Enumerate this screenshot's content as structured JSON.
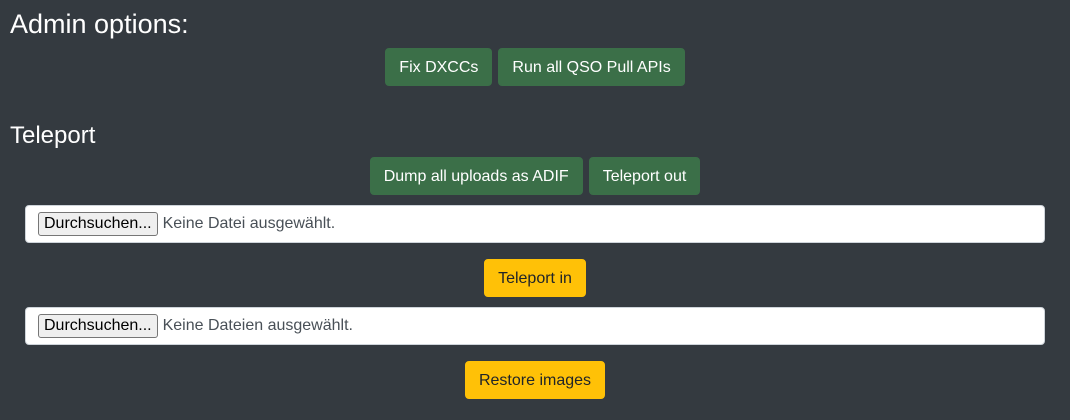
{
  "admin": {
    "title": "Admin options:",
    "buttons": {
      "fix_dxccs": "Fix DXCCs",
      "run_qso_pull": "Run all QSO Pull APIs"
    }
  },
  "teleport": {
    "title": "Teleport",
    "buttons": {
      "dump_adif": "Dump all uploads as ADIF",
      "teleport_out": "Teleport out",
      "teleport_in": "Teleport in",
      "restore_images": "Restore images"
    },
    "file_input_single": {
      "browse_label": "Durchsuchen...",
      "status": "Keine Datei ausgewählt."
    },
    "file_input_multi": {
      "browse_label": "Durchsuchen...",
      "status": "Keine Dateien ausgewählt."
    }
  },
  "colors": {
    "background": "#343a40",
    "success_button": "#3b6f48",
    "warning_button": "#ffc107"
  }
}
